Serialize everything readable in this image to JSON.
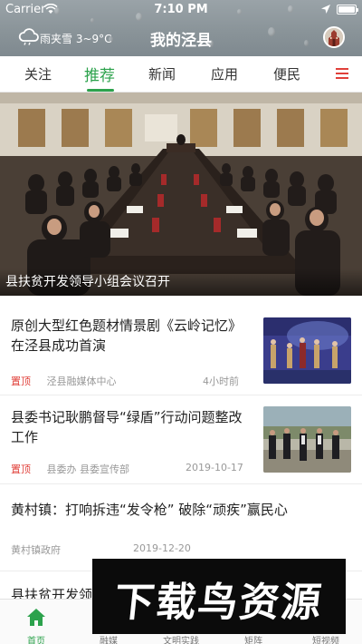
{
  "status_bar": {
    "carrier": "Carrier",
    "time": "7:10 PM"
  },
  "header": {
    "weather": "雨夹雪 3~9°C",
    "title": "我的泾县"
  },
  "nav": {
    "tabs": [
      {
        "label": "关注"
      },
      {
        "label": "推荐",
        "active": true
      },
      {
        "label": "新闻"
      },
      {
        "label": "应用"
      },
      {
        "label": "便民"
      }
    ]
  },
  "hero": {
    "caption": "县扶贫开发领导小组会议召开"
  },
  "news": [
    {
      "title": "原创大型红色题材情景剧《云岭记忆》在泾县成功首演",
      "tag": "置顶",
      "source": "泾县融媒体中心",
      "time": "4小时前",
      "has_thumb": true
    },
    {
      "title": "县委书记耿鹏督导“绿盾”行动问题整改工作",
      "tag": "置顶",
      "source": "县委办 县委宣传部",
      "time": "2019-10-17",
      "has_thumb": true
    },
    {
      "title": "黄村镇：打响拆违“发令枪” 破除“顽疾”赢民心",
      "tag": "",
      "source": "黄村镇政府",
      "time": "2019-12-20",
      "has_thumb": false
    },
    {
      "title": "县扶贫开发领",
      "tag": "",
      "source": "",
      "time": "",
      "has_thumb": false
    }
  ],
  "watermark": {
    "text": "下载鸟资源"
  },
  "tabbar": {
    "items": [
      {
        "label": "首页",
        "icon": "home-icon",
        "active": true
      },
      {
        "label": "融媒",
        "icon": "media-icon"
      },
      {
        "label": "文明实践",
        "icon": "practice-icon"
      },
      {
        "label": "矩阵",
        "icon": "matrix-icon"
      },
      {
        "label": "短视频",
        "icon": "video-icon"
      }
    ]
  },
  "colors": {
    "accent": "#2ca24c",
    "top_tag": "#e0403a",
    "menu_icon": "#e0403a"
  }
}
